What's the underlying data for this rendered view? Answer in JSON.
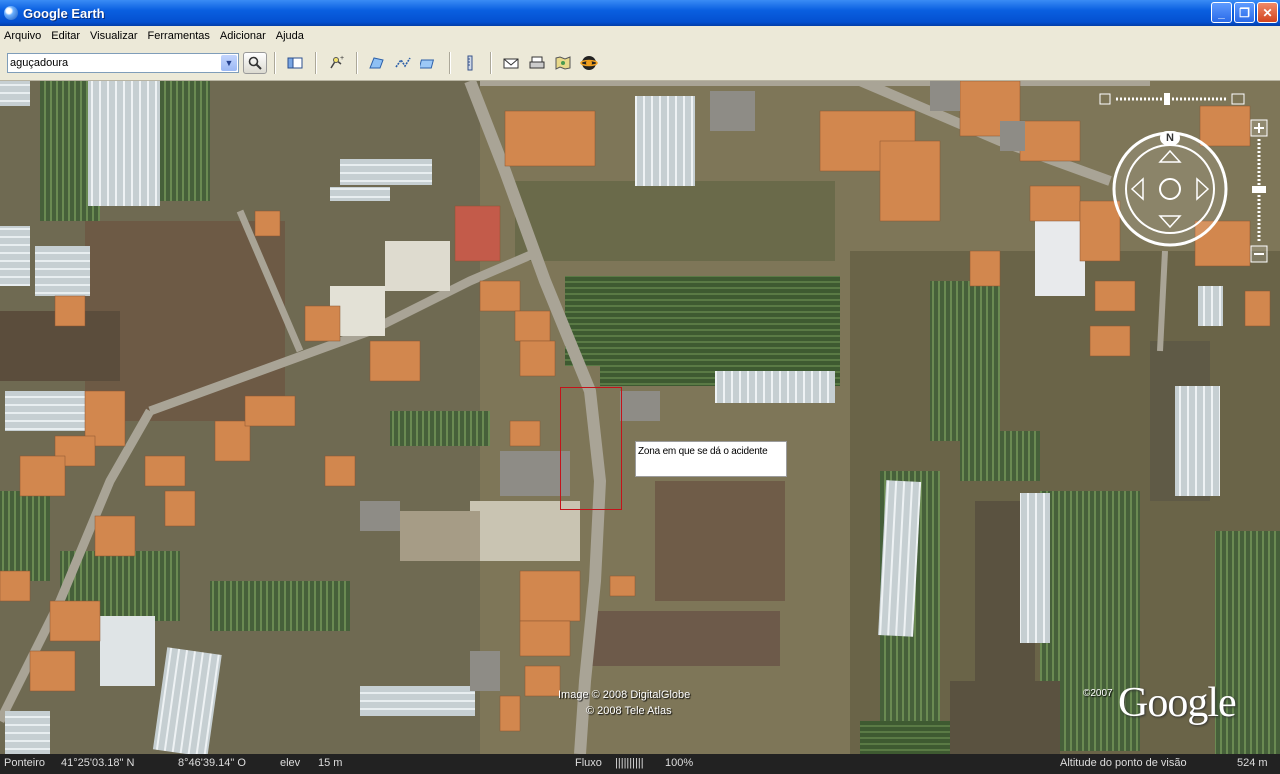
{
  "window": {
    "title": "Google Earth",
    "buttons": {
      "minimize": "_",
      "maximize": "❐",
      "close": "✕"
    }
  },
  "menu": [
    "Arquivo",
    "Editar",
    "Visualizar",
    "Ferramentas",
    "Adicionar",
    "Ajuda"
  ],
  "search": {
    "value": "aguçadoura"
  },
  "toolbar": {
    "icons": [
      "sidebar-icon",
      "placemark-icon",
      "polygon-icon",
      "path-icon",
      "image-overlay-icon",
      "ruler-icon",
      "email-icon",
      "print-icon",
      "google-maps-icon",
      "sky-icon"
    ]
  },
  "map": {
    "annotation": "Zona em que se dá o acidente",
    "credits": {
      "line1": "Image © 2008 DigitalGlobe",
      "line2": "© 2008 Tele Atlas"
    },
    "logo": "Google",
    "logo_year": "©2007",
    "compass_letter": "N"
  },
  "status": {
    "pointer_label": "Ponteiro",
    "latitude": "41°25'03.18\" N",
    "longitude": "8°46'39.14\" O",
    "elev_label": "elev",
    "elev_value": "15 m",
    "stream_label": "Fluxo",
    "stream_bars": "||||||||||",
    "stream_percent": "100%",
    "eye_alt_label": "Altitude do ponto de visão",
    "eye_alt_value": "524 m"
  }
}
